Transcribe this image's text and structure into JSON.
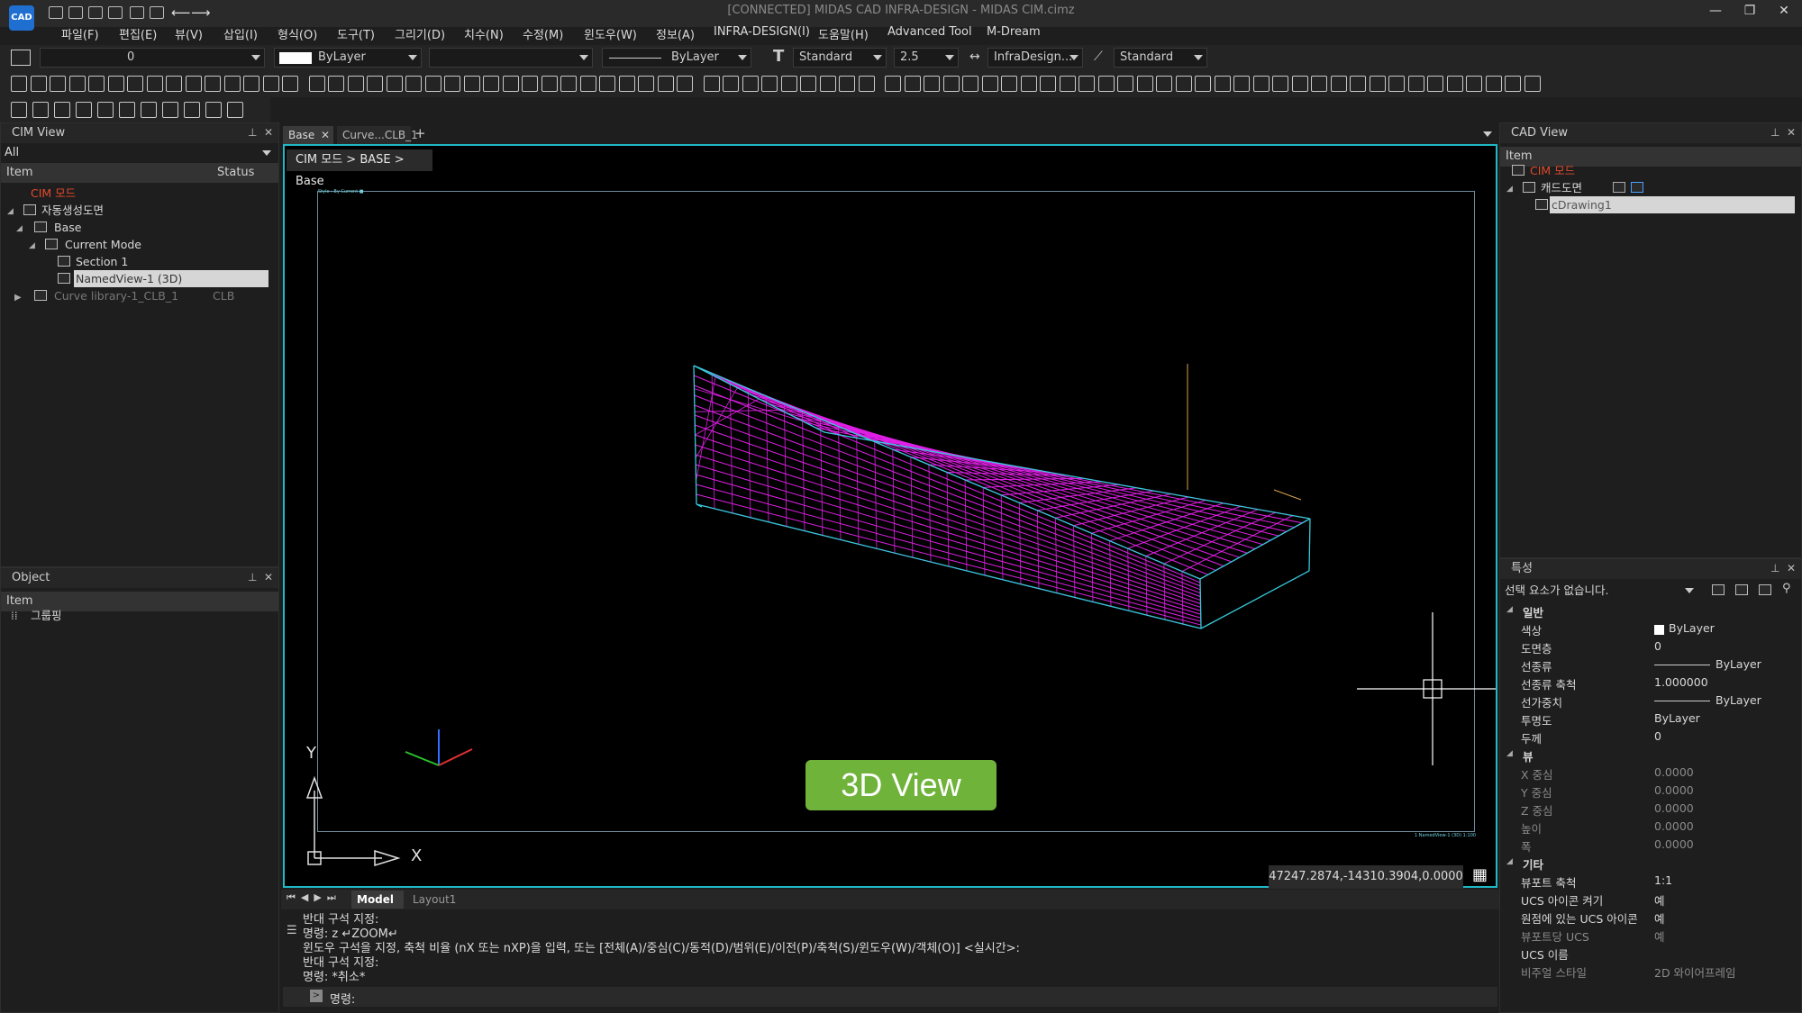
{
  "window": {
    "title": "[CONNECTED] MIDAS CAD INFRA-DESIGN - MIDAS CIM.cimz",
    "logo": "CAD"
  },
  "menu": [
    "파일(F)",
    "편집(E)",
    "뷰(V)",
    "삽입(I)",
    "형식(O)",
    "도구(T)",
    "그리기(D)",
    "치수(N)",
    "수정(M)",
    "윈도우(W)",
    "정보(A)",
    "INFRA-DESIGN(I)",
    "도움말(H)",
    "Advanced Tool",
    "M-Dream"
  ],
  "toolbar": {
    "layer": "0",
    "color": "ByLayer",
    "linetype": "ByLayer",
    "textstyle": "Standard",
    "textsize": "2.5",
    "dimstyle": "InfraDesign...",
    "mlstyle": "Standard"
  },
  "cim_view": {
    "title": "CIM View",
    "filter": "All",
    "col_item": "Item",
    "col_status": "Status",
    "tree": [
      {
        "label": "CIM 모드"
      },
      {
        "label": "자동생성도면"
      },
      {
        "label": "Base"
      },
      {
        "label": "Current Mode"
      },
      {
        "label": "Section 1"
      },
      {
        "label": "NamedView-1 (3D)"
      },
      {
        "label": "Curve library-1_CLB_1",
        "status": "CLB"
      }
    ]
  },
  "object_panel": {
    "title": "Object",
    "col_item": "Item",
    "items": [
      "그룹핑"
    ]
  },
  "tabs": [
    {
      "label": "Base"
    },
    {
      "label": "Curve...CLB_1"
    }
  ],
  "breadcrumb": "CIM 모드 > BASE > Base",
  "viewport": {
    "overlay_label": "3D View",
    "coords": "47247.2874,-14310.3904,0.0000",
    "axis_x": "X",
    "axis_y": "Y",
    "frame_text_tl": "Style : By Current ■",
    "frame_text_br": "1 NamedView-1 (3D) 1:100"
  },
  "layout_tabs": [
    "Model",
    "Layout1"
  ],
  "command": {
    "lines": [
      "반대 구석 지정:",
      "명령: z ↵ZOOM↵",
      "윈도우 구석을 지정, 축척 비율 (nX 또는 nXP)을 입력, 또는 [전체(A)/중심(C)/동적(D)/범위(E)/이전(P)/축척(S)/윈도우(W)/객체(O)] <실시간>:",
      "반대 구석 지정:",
      "명령: *취소*"
    ],
    "prompt": "명령:"
  },
  "cad_view": {
    "title": "CAD View",
    "col_item": "Item",
    "tree": [
      "CIM 모드",
      "캐드도면",
      "cDrawing1"
    ]
  },
  "properties": {
    "title": "특성",
    "selection": "선택 요소가 없습니다.",
    "sections": [
      {
        "name": "일반",
        "rows": [
          [
            "색상",
            "ByLayer"
          ],
          [
            "도면층",
            "0"
          ],
          [
            "선종류",
            "ByLayer"
          ],
          [
            "선종류 축척",
            "1.000000"
          ],
          [
            "선가중치",
            "ByLayer"
          ],
          [
            "투명도",
            "ByLayer"
          ],
          [
            "두께",
            "0"
          ]
        ]
      },
      {
        "name": "뷰",
        "rows": [
          [
            "X 중심",
            "0.0000"
          ],
          [
            "Y 중심",
            "0.0000"
          ],
          [
            "Z 중심",
            "0.0000"
          ],
          [
            "높이",
            "0.0000"
          ],
          [
            "폭",
            "0.0000"
          ]
        ]
      },
      {
        "name": "기타",
        "rows": [
          [
            "뷰포트 축척",
            "1:1"
          ],
          [
            "UCS 아이콘 켜기",
            "예"
          ],
          [
            "원점에 있는 UCS 아이콘",
            "예"
          ],
          [
            "뷰포트당 UCS",
            "예"
          ],
          [
            "UCS 이름",
            ""
          ],
          [
            "비주얼 스타일",
            "2D 와이어프레임"
          ]
        ]
      }
    ]
  }
}
